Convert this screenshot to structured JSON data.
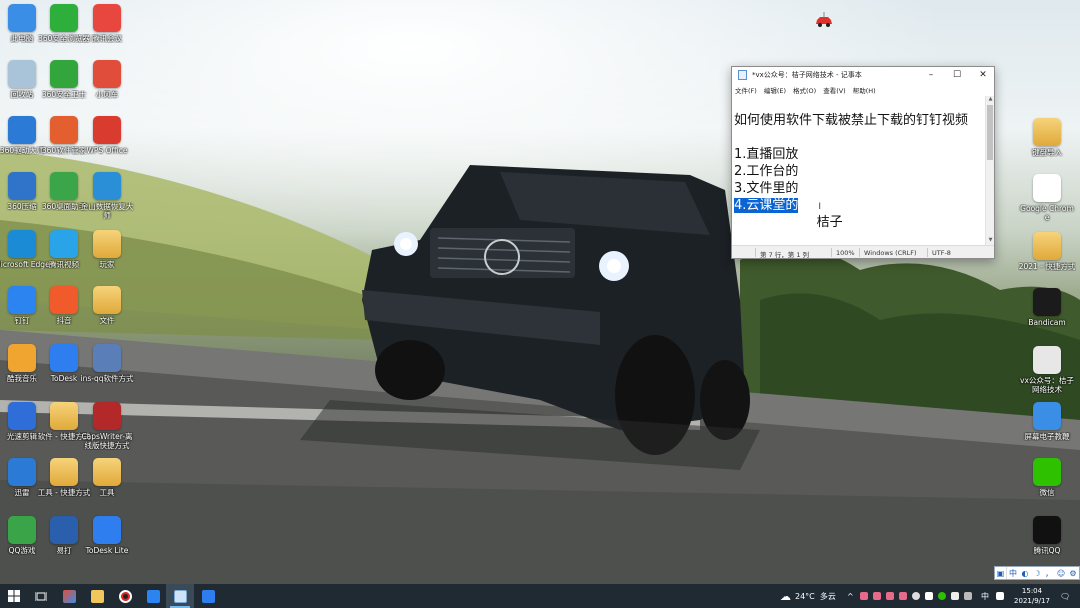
{
  "colors": {
    "taskbar": "#1f2a33",
    "selection": "#0a64d2",
    "accent": "#76b9ed"
  },
  "desktop_left": [
    {
      "label": "此电脑",
      "icon": "computer-icon",
      "color": "#3a8ee6"
    },
    {
      "label": "360安全浏览器",
      "icon": "360-browser-icon",
      "color": "#2eae3a"
    },
    {
      "label": "腾讯会议",
      "icon": "meeting-icon",
      "color": "#e8473f"
    },
    {
      "label": "回收站",
      "icon": "recycle-bin-icon",
      "color": "#a9c4d8"
    },
    {
      "label": "360安全卫士",
      "icon": "360-guard-icon",
      "color": "#33a63b"
    },
    {
      "label": "小风车",
      "icon": "pinwheel-icon",
      "color": "#e04e3b"
    },
    {
      "label": "360驱动大师",
      "icon": "driver-icon",
      "color": "#2a7ad6"
    },
    {
      "label": "360软件管家",
      "icon": "software-manager-icon",
      "color": "#e35f2f"
    },
    {
      "label": "WPS Office",
      "icon": "wps-icon",
      "color": "#d93b2f"
    },
    {
      "label": "360压缩",
      "icon": "zip-icon",
      "color": "#2f74c9"
    },
    {
      "label": "360桌面助手",
      "icon": "desktop-helper-icon",
      "color": "#3ba54a"
    },
    {
      "label": "金山数据恢复大师",
      "icon": "recovery-icon",
      "color": "#2b8fd8"
    },
    {
      "label": "Microsoft Edge",
      "icon": "edge-icon",
      "color": "#1c8bd6"
    },
    {
      "label": "腾讯视频",
      "icon": "tencent-video-icon",
      "color": "#2aa4e8"
    },
    {
      "label": "玩家",
      "icon": "folder-icon",
      "color": "folder"
    },
    {
      "label": "钉钉",
      "icon": "dingtalk-icon",
      "color": "#2b84f0"
    },
    {
      "label": "抖音",
      "icon": "douyin-icon",
      "color": "#f15a2a"
    },
    {
      "label": "文件",
      "icon": "folder-icon",
      "color": "folder"
    },
    {
      "label": "酷我音乐",
      "icon": "music-icon",
      "color": "#f0a531"
    },
    {
      "label": "ToDesk",
      "icon": "todesk-icon",
      "color": "#2f7ef0"
    },
    {
      "label": "ins-qq软件方式",
      "icon": "shortcut-icon",
      "color": "#5a7fb8"
    },
    {
      "label": "光速剪辑",
      "icon": "editor-icon",
      "color": "#2f6ed8"
    },
    {
      "label": "软件 - 快捷方式",
      "icon": "folder-icon",
      "color": "folder"
    },
    {
      "label": "CapsWriter-离线版快捷方式",
      "icon": "capswriter-icon",
      "color": "#b32828"
    },
    {
      "label": "迅雷",
      "icon": "thunder-icon",
      "color": "#2a7ad6"
    },
    {
      "label": "工具 - 快捷方式",
      "icon": "folder-icon",
      "color": "folder"
    },
    {
      "label": "工具",
      "icon": "folder-icon",
      "color": "folder"
    },
    {
      "label": "QQ游戏",
      "icon": "qq-game-icon",
      "color": "#3aa548"
    },
    {
      "label": "易打",
      "icon": "print-icon",
      "color": "#2a5fae"
    },
    {
      "label": "ToDesk Lite",
      "icon": "todesk-lite-icon",
      "color": "#2f7ef0"
    }
  ],
  "desktop_right": [
    {
      "label": "键盘导入",
      "icon": "folder-icon",
      "color": "folder"
    },
    {
      "label": "Google Chrome",
      "icon": "chrome-icon",
      "color": "#ffffff"
    },
    {
      "label": "2021 - 快捷方式",
      "icon": "folder-icon",
      "color": "folder"
    },
    {
      "label": "Bandicam",
      "icon": "bandicam-icon",
      "color": "#1b1b1b"
    },
    {
      "label": "vx公众号：桔子网络技术",
      "icon": "notepad-file-icon",
      "color": "#e7e7e7"
    },
    {
      "label": "屏幕电子教鞭",
      "icon": "screen-pen-icon",
      "color": "#3a8ee6"
    },
    {
      "label": "微信",
      "icon": "wechat-icon",
      "color": "#2dc100"
    },
    {
      "label": "腾讯QQ",
      "icon": "qq-icon",
      "color": "#111111"
    }
  ],
  "notepad": {
    "title": "*vx公众号：桔子网络技术 - 记事本",
    "menu": [
      "文件(F)",
      "编辑(E)",
      "格式(O)",
      "查看(V)",
      "帮助(H)"
    ],
    "lines": [
      "如何使用软件下载被禁止下载的钉钉视频",
      "",
      "1.直播回放",
      "2.工作台的",
      "3.文件里的",
      "4.云课堂的",
      "                    桔子"
    ],
    "status": {
      "position": "第 7 行，第 1 列",
      "zoom": "100%",
      "eol": "Windows (CRLF)",
      "encoding": "UTF-8"
    }
  },
  "taskbar": {
    "weather": "24°C  多云",
    "ime_mode": "中",
    "time": "15:04",
    "date": "2021/9/17"
  },
  "ime_bar": [
    "中",
    "◐",
    "☽",
    "，",
    "☺",
    "⚙"
  ]
}
